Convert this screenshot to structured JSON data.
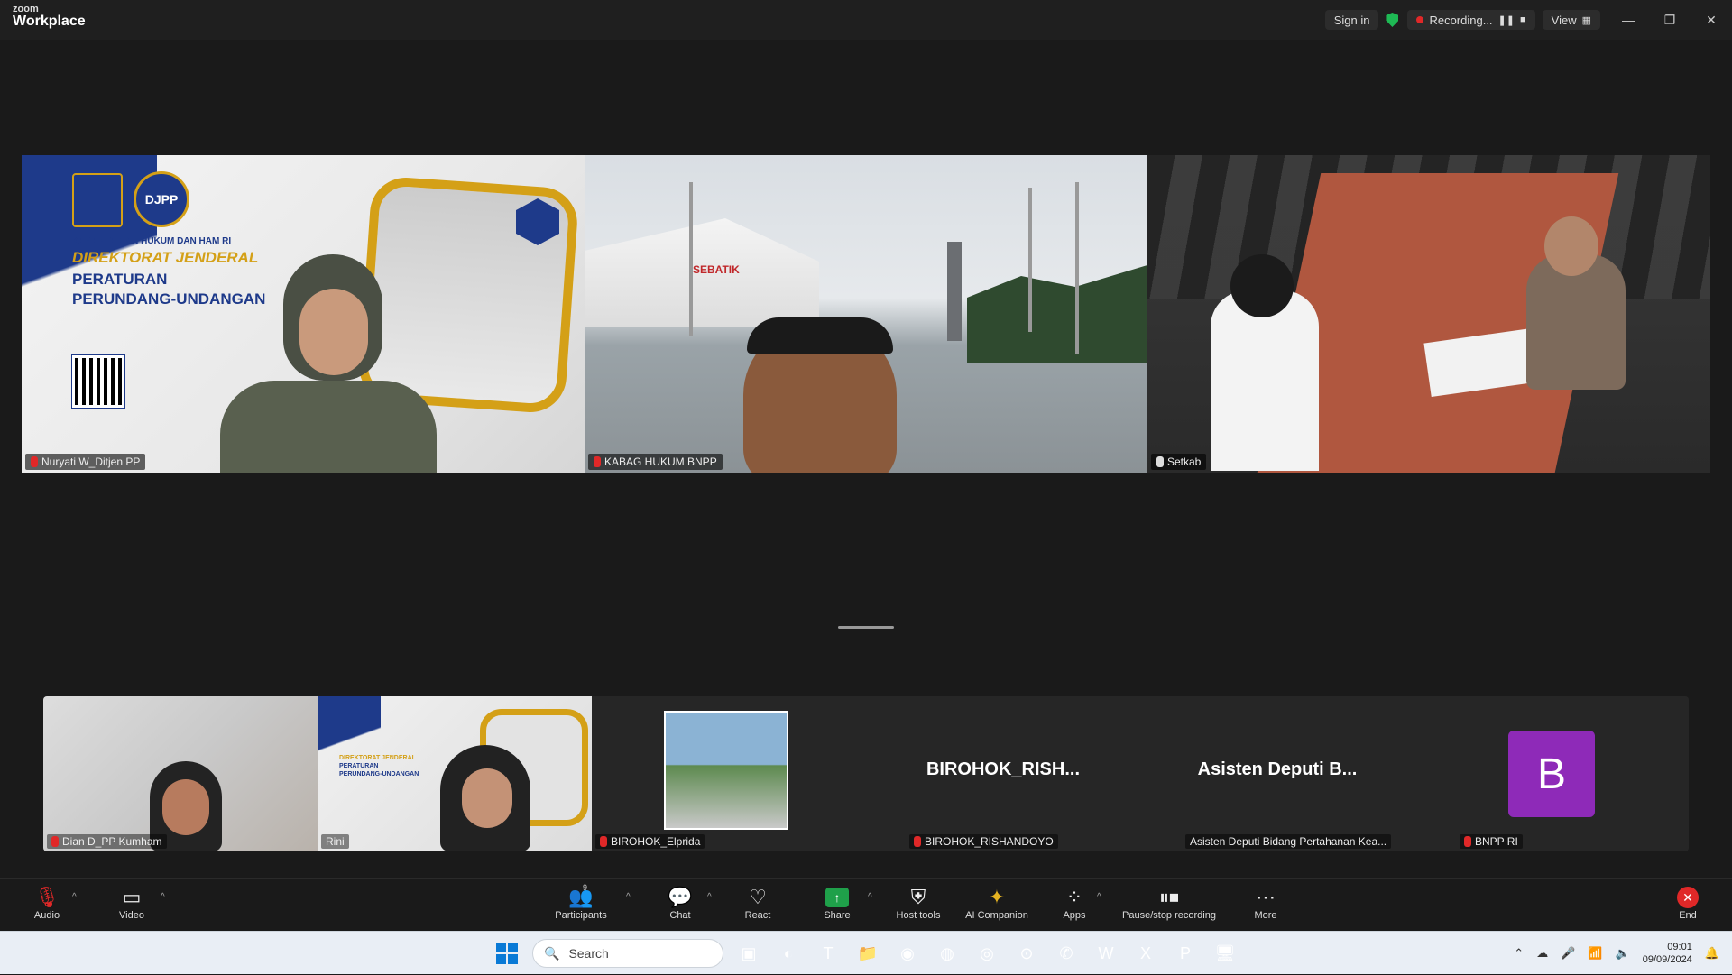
{
  "app": {
    "brand_small": "zoom",
    "brand_big": "Workplace"
  },
  "titlebar": {
    "sign_in": "Sign in",
    "recording": "Recording...",
    "view": "View",
    "window_controls": [
      "minimize-icon",
      "restore-icon",
      "close-icon"
    ]
  },
  "main_tiles": [
    {
      "name": "Nuryati W_Ditjen PP",
      "mic": "muted",
      "banner": {
        "logo2": "DJPP",
        "line1": "KEMENTERIAN HUKUM DAN HAM RI",
        "line2": "DIREKTORAT JENDERAL",
        "line3": "PERATURAN",
        "line4": "PERUNDANG-UNDANGAN"
      }
    },
    {
      "name": "KABAG HUKUM BNPP",
      "mic": "muted",
      "sign": "SEBATIK"
    },
    {
      "name": "Setkab",
      "mic": "on"
    }
  ],
  "gallery": [
    {
      "name": "Dian D_PP Kumham",
      "mic": "muted",
      "type": "video"
    },
    {
      "name": "Rini",
      "mic": "none",
      "type": "video"
    },
    {
      "name": "BIROHOK_Elprida",
      "mic": "muted",
      "type": "picture"
    },
    {
      "name": "BIROHOK_RISHANDOYO",
      "mic": "muted",
      "type": "name",
      "display": "BIROHOK_RISH..."
    },
    {
      "name": "Asisten Deputi Bidang Pertahanan Kea...",
      "mic": "none",
      "type": "name",
      "display": "Asisten Deputi B..."
    },
    {
      "name": "BNPP RI",
      "mic": "muted",
      "type": "avatar",
      "initial": "B",
      "avatar_color": "#8e2ab8"
    }
  ],
  "toolbar": {
    "audio": "Audio",
    "video": "Video",
    "participants": "Participants",
    "participants_count": "9",
    "chat": "Chat",
    "react": "React",
    "share": "Share",
    "host_tools": "Host tools",
    "ai_companion": "AI Companion",
    "apps": "Apps",
    "pause_stop_recording": "Pause/stop recording",
    "more": "More",
    "end": "End"
  },
  "taskbar": {
    "search_placeholder": "Search",
    "time": "09:01",
    "date": "09/09/2024"
  },
  "colors": {
    "accent_share": "#1fa04a",
    "end_red": "#e02828",
    "recording_red": "#e02828",
    "shield_green": "#1eb954"
  }
}
